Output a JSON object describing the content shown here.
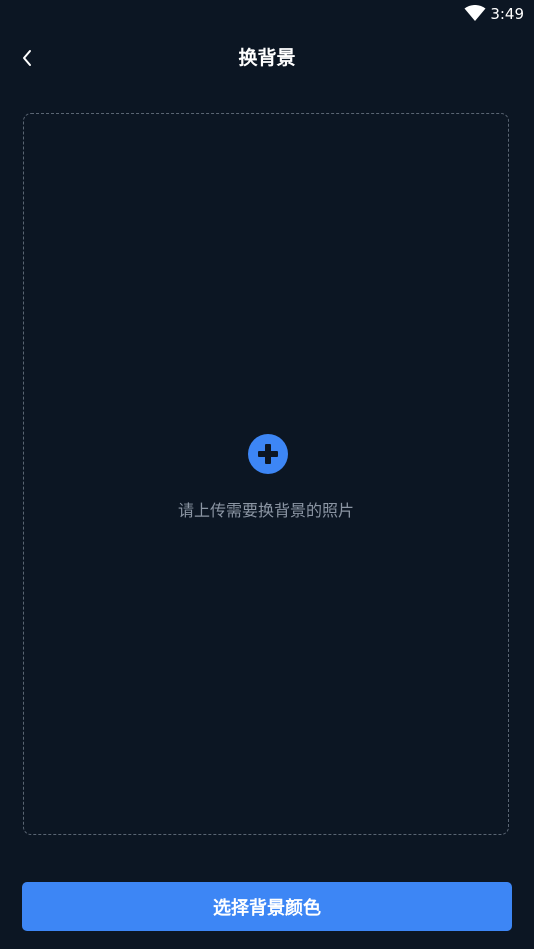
{
  "status_bar": {
    "time": "3:49",
    "wifi_icon": "wifi-icon"
  },
  "header": {
    "title": "换背景",
    "back_icon": "chevron-left-icon"
  },
  "upload": {
    "icon": "plus-circle-icon",
    "hint": "请上传需要换背景的照片"
  },
  "footer": {
    "button_label": "选择背景颜色"
  },
  "colors": {
    "background": "#0c1623",
    "accent": "#3d86f5",
    "hint_text": "#8b95a3",
    "dashed_border": "#5a6573"
  }
}
